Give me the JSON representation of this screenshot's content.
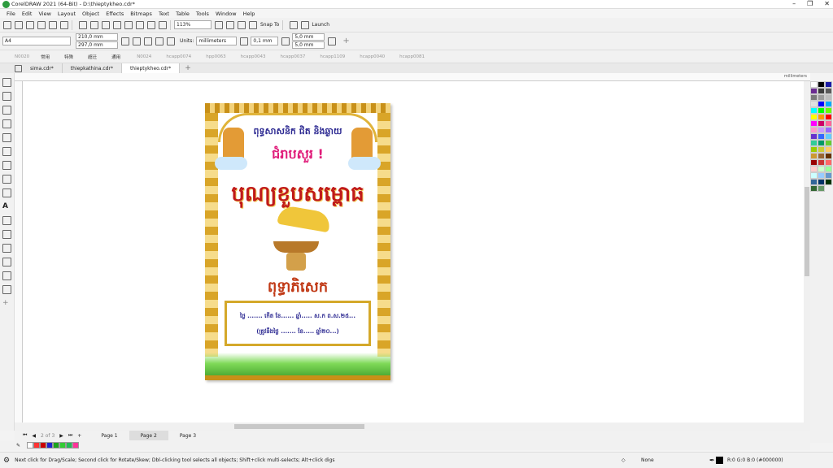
{
  "title": "CorelDRAW 2021 (64-Bit) - D:\\thieptykheo.cdr*",
  "menu": [
    "File",
    "Edit",
    "View",
    "Layout",
    "Object",
    "Effects",
    "Bitmaps",
    "Text",
    "Table",
    "Tools",
    "Window",
    "Help"
  ],
  "standard": {
    "zoom": "113%",
    "snap_to": "Snap To",
    "launch": "Launch"
  },
  "property": {
    "page_size": "A4",
    "width": "210,0 mm",
    "height": "297,0 mm",
    "units_label": "Units:",
    "units": "millimeters",
    "nudge": "0,1 mm",
    "dup_x": "5,0 mm",
    "dup_y": "5,0 mm"
  },
  "favorites": [
    "N0020",
    "常用",
    "特殊",
    "超迁",
    "通用",
    "N0024",
    "hcapp0074",
    "hpp0063",
    "hcapp0043",
    "hcapp0037",
    "hcapp1109",
    "hcapp0040",
    "hcapp0081"
  ],
  "doc_tabs": [
    "sima.cdr*",
    "thiepkathina.cdr*",
    "thieptykheo.cdr*"
  ],
  "active_tab": 2,
  "ruler_unit": "millimeters",
  "pages": {
    "indicator": "2 of 3",
    "tabs": [
      "Page 1",
      "Page 2",
      "Page 3"
    ],
    "active": 1
  },
  "artwork": {
    "line1": "ពុទ្ធសាសនិក ជិត និងឆ្ងាយ",
    "line2": "ជំរាបសួរ !",
    "line3": "បុណ្យខួបសម្ពោធ",
    "line4": "ពុទ្ធាភិសេក",
    "info1": "ថ្ងៃ ....... កើត ខែ...... ឆ្នាំ..... ស.ក ព.ស.២៥...",
    "info2": "(ត្រូវនឹងថ្ងៃ ....... ខែ..... ឆ្នាំ២០...)"
  },
  "status": {
    "hint": "Next click for Drag/Scale; Second click for Rotate/Skew; Dbl-clicking tool selects all objects; Shift+click multi-selects; Alt+click digs",
    "fill": "None",
    "color": "R:0 G:0 B:0 (#000000)"
  },
  "palette_colors": [
    "#ffffff",
    "#000000",
    "#1a1aa6",
    "#6b2c91",
    "#3d3d3d",
    "#5a5a5a",
    "#7a7a7a",
    "#9a9a9a",
    "#bdbdbd",
    "#e0e0e0",
    "#0000ff",
    "#00aaff",
    "#00ffff",
    "#00ff00",
    "#66ff00",
    "#ffff00",
    "#ff9900",
    "#ff0000",
    "#ff00ff",
    "#cc0066",
    "#ff6699",
    "#ff99cc",
    "#cc99ff",
    "#9966ff",
    "#6633cc",
    "#3366ff",
    "#66ccff",
    "#33cc99",
    "#009966",
    "#66cc33",
    "#99cc00",
    "#cccc33",
    "#ffcc66",
    "#cc9933",
    "#996633",
    "#663300",
    "#990000",
    "#cc3333",
    "#ff6666",
    "#ffcccc",
    "#ccffcc",
    "#99ff99",
    "#ccffff",
    "#99ccff",
    "#6699cc",
    "#336699",
    "#003366",
    "#003300",
    "#336633",
    "#669966"
  ],
  "doc_palette": [
    "#ffffff",
    "#ff3333",
    "#cc0000",
    "#2222cc",
    "#1aa31a",
    "#33cc33",
    "#22bb55",
    "#ff3399"
  ]
}
